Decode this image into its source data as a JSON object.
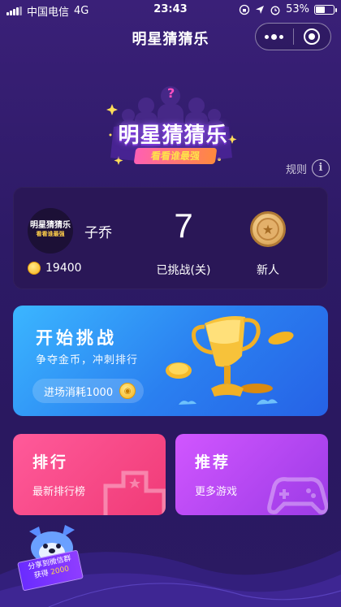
{
  "status_bar": {
    "carrier": "中国电信",
    "network": "4G",
    "time": "23:43",
    "battery": "53%",
    "battery_level": 0.53
  },
  "nav": {
    "title": "明星猜猜乐",
    "more_icon": "more-dots-icon",
    "close_icon": "target-icon"
  },
  "logo": {
    "main": "明星猜猜乐",
    "sub": "看看谁最强"
  },
  "rules": {
    "label": "规则",
    "icon": "i"
  },
  "profile": {
    "avatar_title": "明星猜猜乐",
    "avatar_sub": "看看谁最强",
    "name": "子乔",
    "coins": "19400",
    "challenged_count": "7",
    "challenged_label": "已挑战(关)",
    "rank": "新人",
    "medal_icon": "★"
  },
  "start": {
    "title": "开始挑战",
    "subtitle": "争夺金币，冲刺排行",
    "cost": "进场消耗1000"
  },
  "ranking": {
    "title": "排行",
    "subtitle": "最新排行榜"
  },
  "recommend": {
    "title": "推荐",
    "subtitle": "更多游戏"
  },
  "share": {
    "line1": "分享到微信群",
    "line2_prefix": "获得",
    "line2_amount": "2000"
  },
  "colors": {
    "background": "#2d1a66",
    "card": "#2a1757",
    "start_card": "#2a7ff0",
    "rank_card": "#f03b77",
    "recommend_card": "#9c3be6",
    "coin": "#f6b21b"
  }
}
